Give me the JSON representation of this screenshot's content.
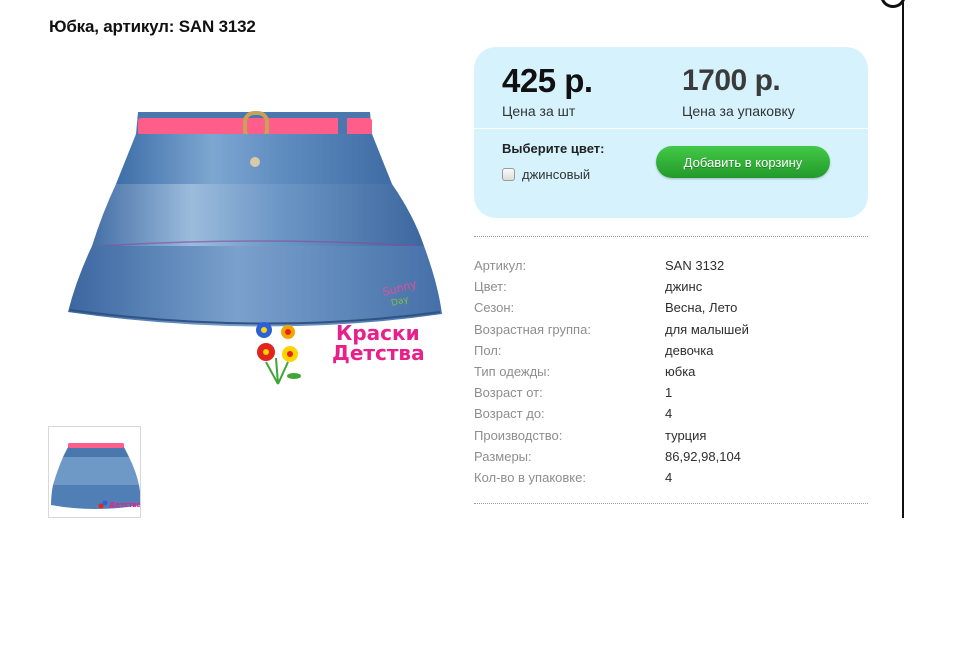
{
  "product": {
    "title": "Юбка, артикул: SAN 3132",
    "main_image_alt": "Джинсовая юбка с розовым поясом",
    "brand_logo": {
      "line1": "Краски",
      "line2": "Детства"
    }
  },
  "prices": {
    "unit_value": "425 р.",
    "unit_caption": "Цена за шт",
    "pack_value": "1700 р.",
    "pack_caption": "Цена за упаковку"
  },
  "color_selector": {
    "label": "Выберите цвет:",
    "options": [
      {
        "label": "джинсовый",
        "checked": false
      }
    ]
  },
  "cart_button_label": "Добавить в корзину",
  "specs": [
    {
      "key": "Артикул:",
      "value": "SAN 3132"
    },
    {
      "key": "Цвет:",
      "value": "джинс"
    },
    {
      "key": "Сезон:",
      "value": "Весна, Лето"
    },
    {
      "key": "Возрастная группа:",
      "value": "для малышей"
    },
    {
      "key": "Пол:",
      "value": "девочка"
    },
    {
      "key": "Тип одежды:",
      "value": "юбка"
    },
    {
      "key": "Возраст от:",
      "value": "1"
    },
    {
      "key": "Возраст до:",
      "value": "4"
    },
    {
      "key": "Производство:",
      "value": "турция"
    },
    {
      "key": "Размеры:",
      "value": "86,92,98,104"
    },
    {
      "key": "Кол-во в упаковке:",
      "value": "4"
    }
  ],
  "colors": {
    "panel_bg": "#d6f3fd",
    "cart_green": "#2eb33a",
    "denim": "#4f7fb5",
    "belt_pink": "#ff5e8a"
  }
}
